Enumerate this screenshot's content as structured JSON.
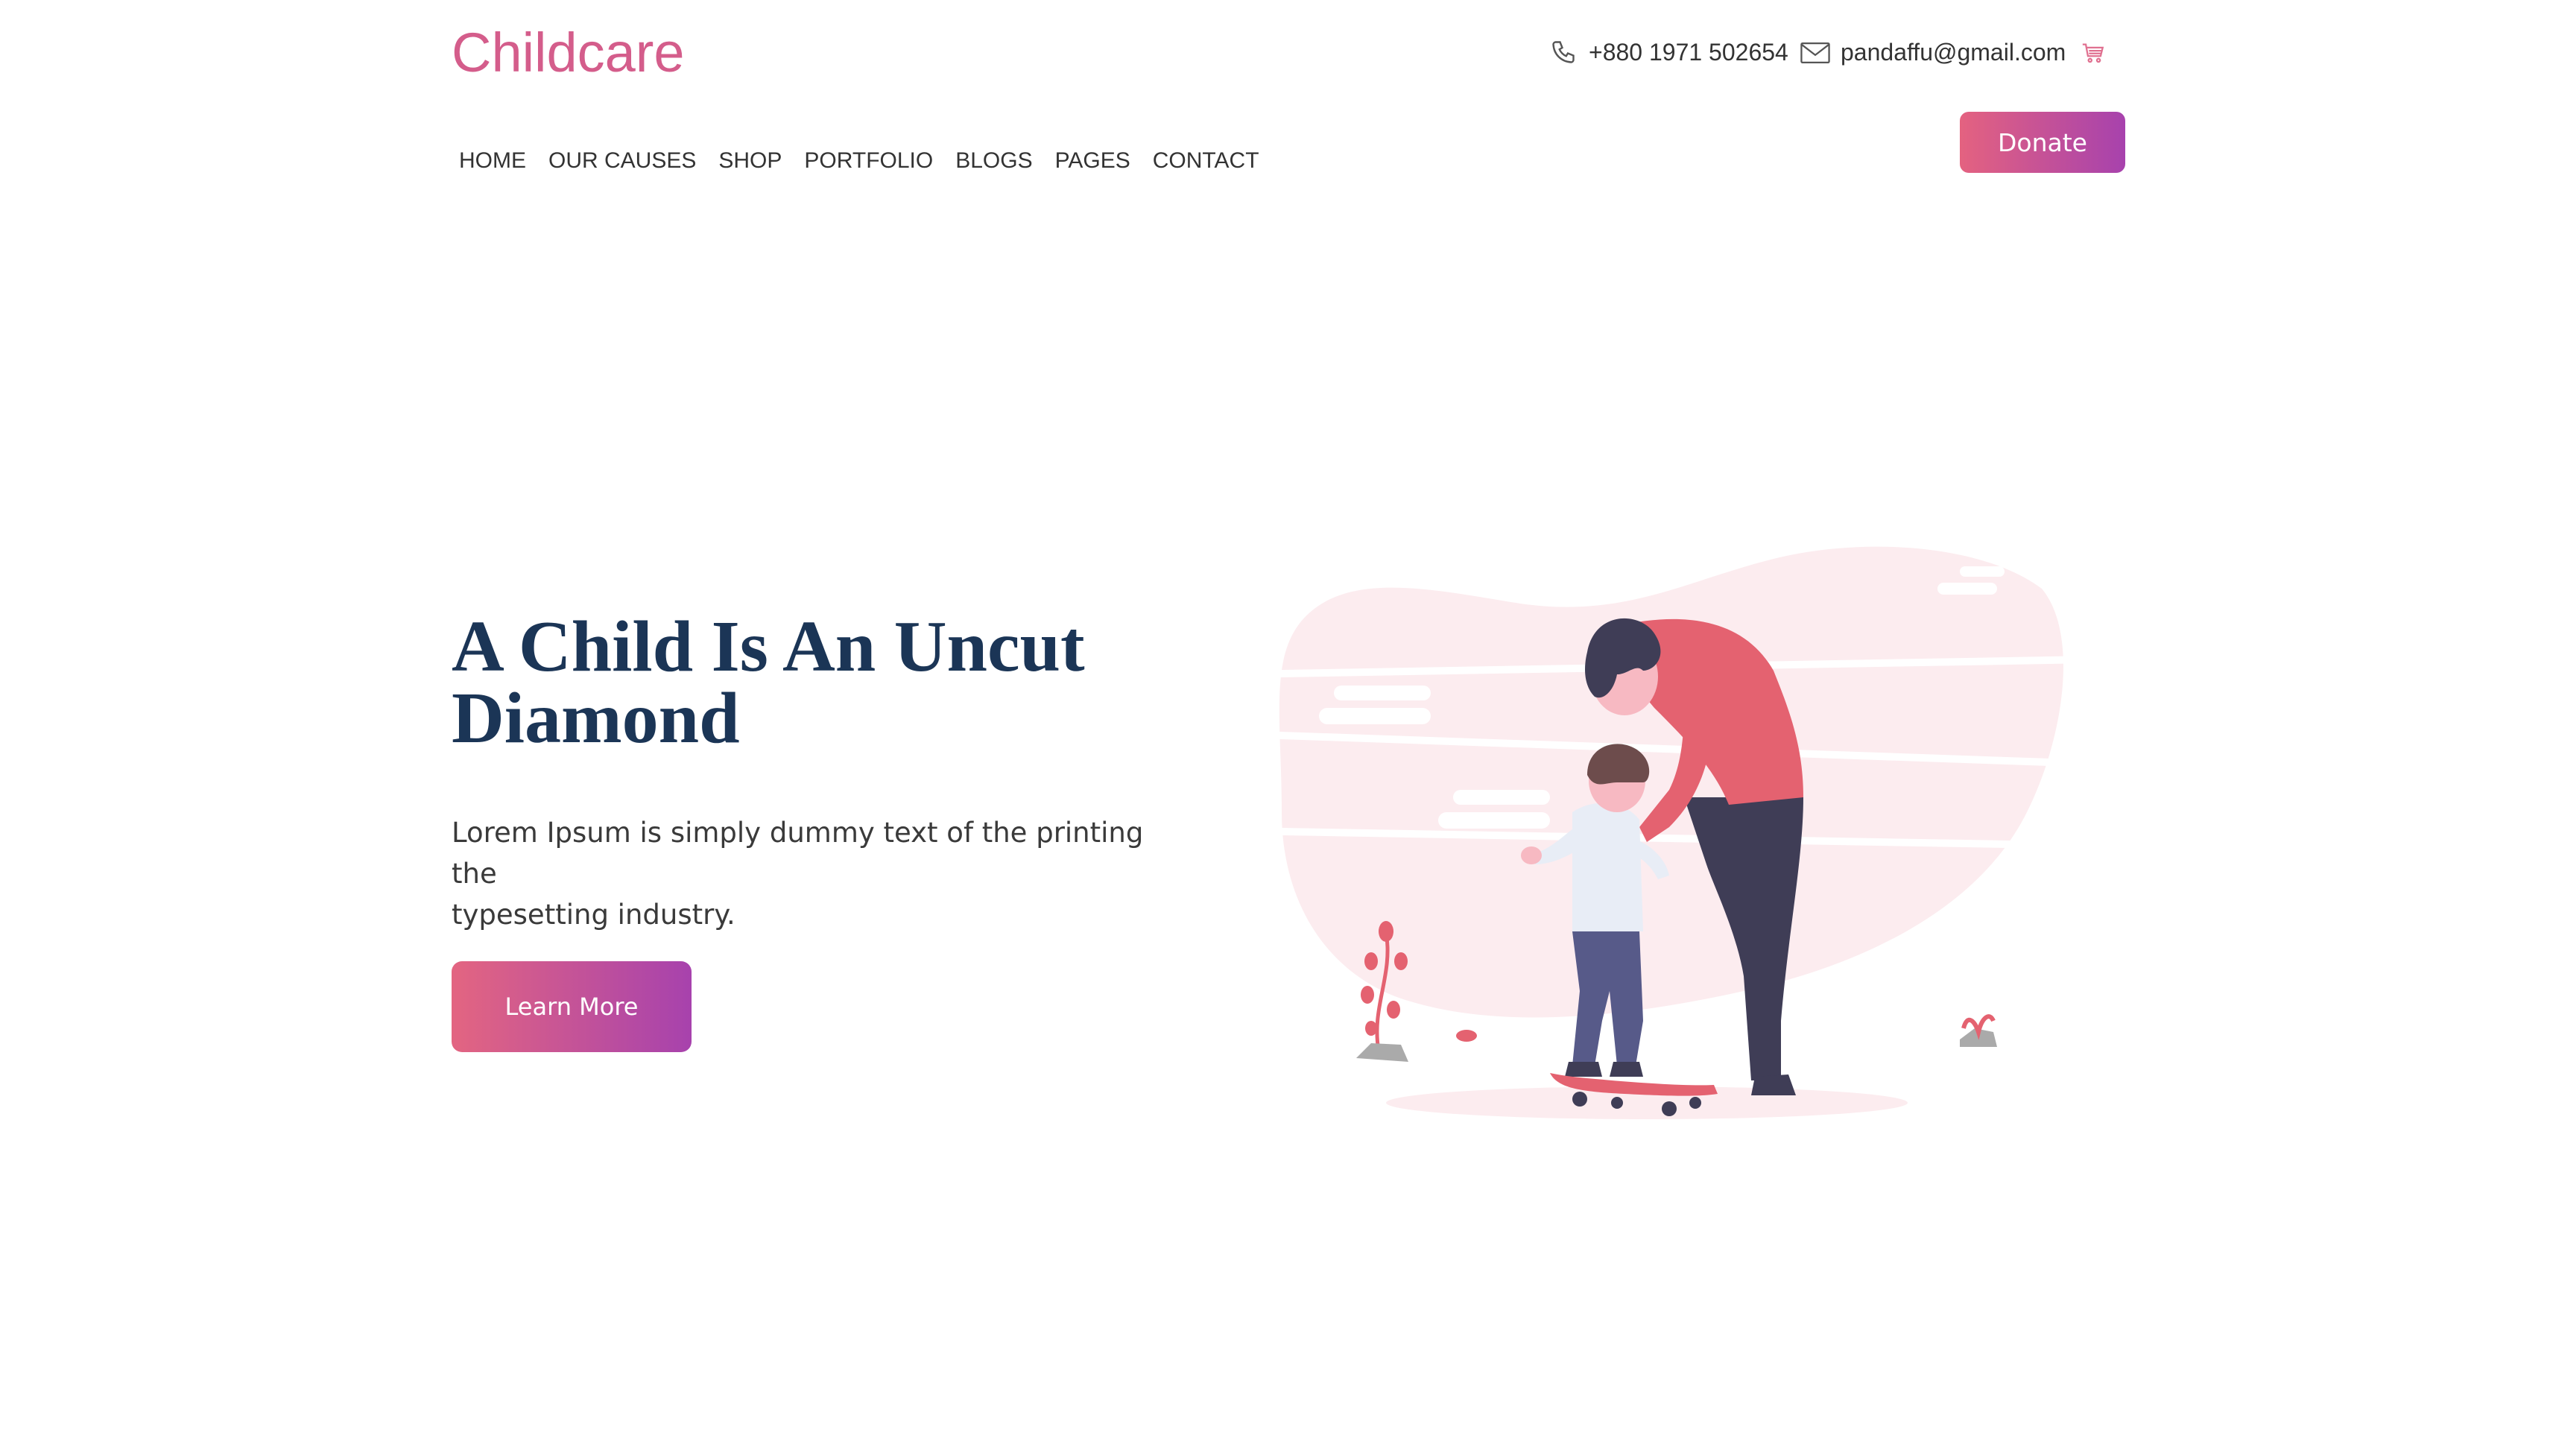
{
  "brand": {
    "name": "Childcare",
    "color": "#d45d8b"
  },
  "contact": {
    "phone_icon": "phone-icon",
    "phone": "+880 1971 502654",
    "mail_icon": "mail-icon",
    "email": "pandaffu@gmail.com",
    "cart_icon": "cart-icon"
  },
  "nav": {
    "items": [
      {
        "label": "HOME"
      },
      {
        "label": "OUR CAUSES"
      },
      {
        "label": "SHOP"
      },
      {
        "label": "PORTFOLIO"
      },
      {
        "label": "BLOGS"
      },
      {
        "label": "PAGES"
      },
      {
        "label": "CONTACT"
      }
    ]
  },
  "donate": {
    "label": "Donate"
  },
  "hero": {
    "title_line1": "A Child Is An Uncut",
    "title_line2": "Diamond",
    "text_line1": "Lorem Ipsum is simply dummy text of the printing the",
    "text_line2": "typesetting industry.",
    "button_label": "Learn More"
  },
  "colors": {
    "accent_start": "#e46280",
    "accent_end": "#a742ad",
    "title": "#1b3556",
    "illustration_bg": "#fcecef",
    "shirt": "#e46270",
    "pants": "#3f3d56"
  }
}
